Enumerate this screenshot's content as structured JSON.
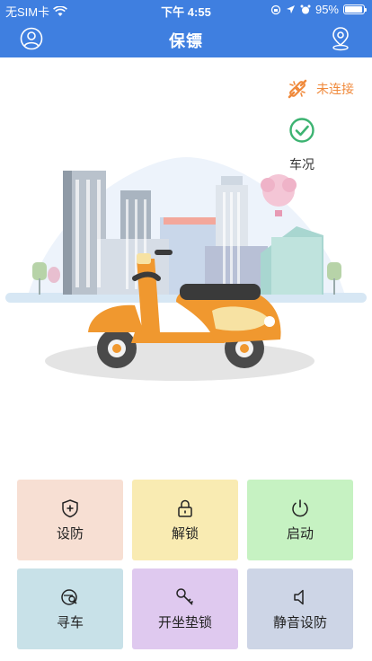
{
  "status_bar": {
    "carrier": "无SIM卡",
    "time": "下午 4:55",
    "battery": "95%",
    "battery_level": 0.95
  },
  "nav": {
    "title": "保镖",
    "left_icon": "user-icon",
    "right_icon": "location-pin-icon"
  },
  "connection": {
    "label": "未连接",
    "icon": "broken-link-icon",
    "color": "#f08a3c"
  },
  "condition": {
    "label": "车况",
    "icon": "check-circle-icon",
    "color": "#3cb371"
  },
  "scene": {
    "illustration": "orange-scooter-in-front-of-city-skyline"
  },
  "actions": [
    {
      "label": "设防",
      "icon": "shield-plus-icon",
      "bg": "#f7dfd3"
    },
    {
      "label": "解锁",
      "icon": "unlock-icon",
      "bg": "#f9ebb2"
    },
    {
      "label": "启动",
      "icon": "power-icon",
      "bg": "#c6f2c2"
    },
    {
      "label": "寻车",
      "icon": "find-car-icon",
      "bg": "#c8e1e8"
    },
    {
      "label": "开坐垫锁",
      "icon": "key-icon",
      "bg": "#dfc9ef"
    },
    {
      "label": "静音设防",
      "icon": "mute-speaker-icon",
      "bg": "#cdd5e6"
    }
  ],
  "colors": {
    "primary": "#3f7fe0",
    "scooter": "#f0982f"
  }
}
